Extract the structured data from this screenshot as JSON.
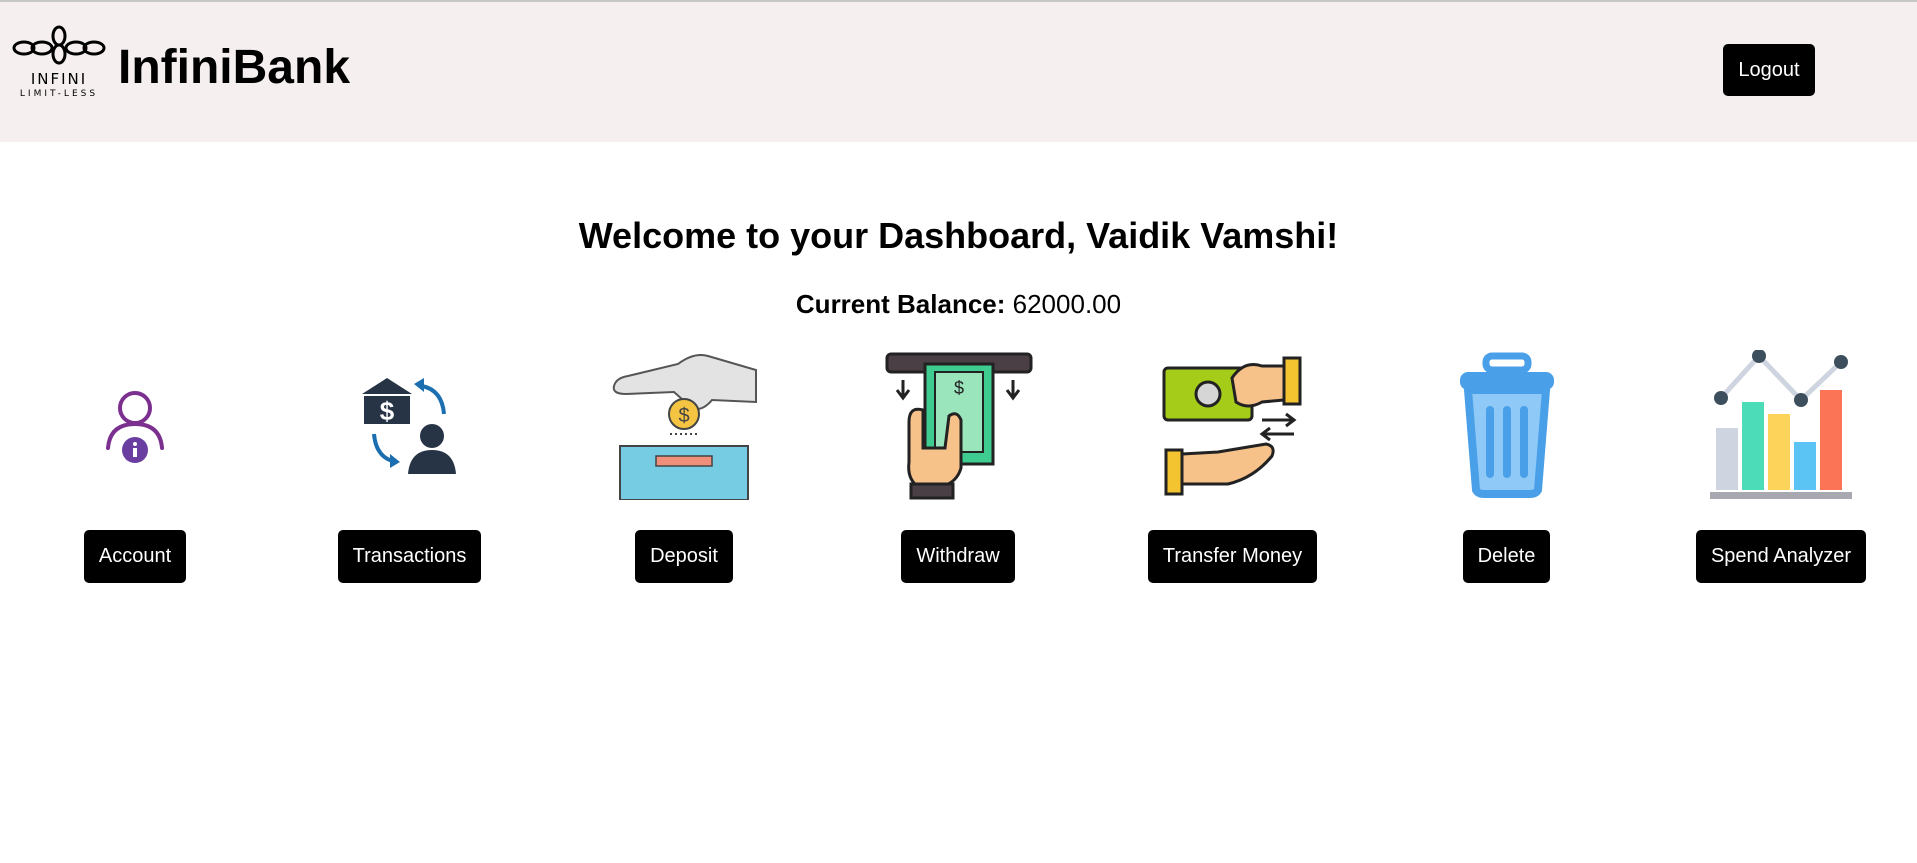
{
  "header": {
    "logo_line1": "INFINI",
    "logo_line2": "LIMIT-LESS",
    "brand": "InfiniBank",
    "logout_label": "Logout"
  },
  "main": {
    "welcome": "Welcome to your Dashboard, Vaidik Vamshi!",
    "balance_label": "Current Balance:",
    "balance_value": "62000.00"
  },
  "actions": [
    {
      "label": "Account",
      "icon": "account-info-icon"
    },
    {
      "label": "Transactions",
      "icon": "bank-transactions-icon"
    },
    {
      "label": "Deposit",
      "icon": "deposit-coin-icon"
    },
    {
      "label": "Withdraw",
      "icon": "atm-withdraw-icon"
    },
    {
      "label": "Transfer Money",
      "icon": "money-transfer-icon"
    },
    {
      "label": "Delete",
      "icon": "trash-icon"
    },
    {
      "label": "Spend Analyzer",
      "icon": "bar-chart-icon"
    }
  ],
  "colors": {
    "header_bg": "#f5efef",
    "button_bg": "#000000",
    "button_text": "#ffffff"
  }
}
